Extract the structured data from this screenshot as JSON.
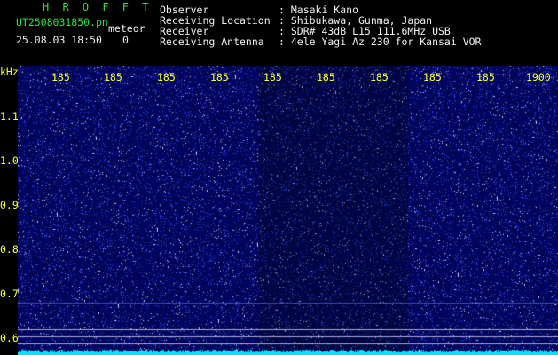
{
  "header": {
    "app_title": "H R O F F T",
    "file_name": "UT2508031850.pn",
    "meteor_label": "meteor",
    "date_time": "25.08.03 18:50",
    "meteor_count": "0",
    "info": [
      {
        "label": "Observer",
        "value": ": Masaki Kano"
      },
      {
        "label": "Receiving Location",
        "value": ": Shibukawa, Gunma, Japan"
      },
      {
        "label": "Receiver",
        "value": ": SDR# 43dB L15 111.6MHz USB"
      },
      {
        "label": "Receiving Antenna",
        "value": ": 4ele Yagi Az 230 for Kansai VOR"
      }
    ]
  },
  "axes": {
    "y_unit": "kHz",
    "x_ticks": [
      "185",
      "185",
      "185",
      "185",
      "185",
      "185",
      "185",
      "185",
      "185",
      "1900"
    ],
    "y_ticks": [
      "1.1",
      "1.0",
      "0.9",
      "0.8",
      "0.7",
      "0.6"
    ]
  },
  "colors": {
    "background": "#000000",
    "spectrogram": "#101a66",
    "noise_dots": "#3a4cff",
    "signal_trace": "#00e5ff",
    "tick_color": "#ffff33",
    "title_color": "#33dd44",
    "text_color": "#f0f0f0"
  }
}
